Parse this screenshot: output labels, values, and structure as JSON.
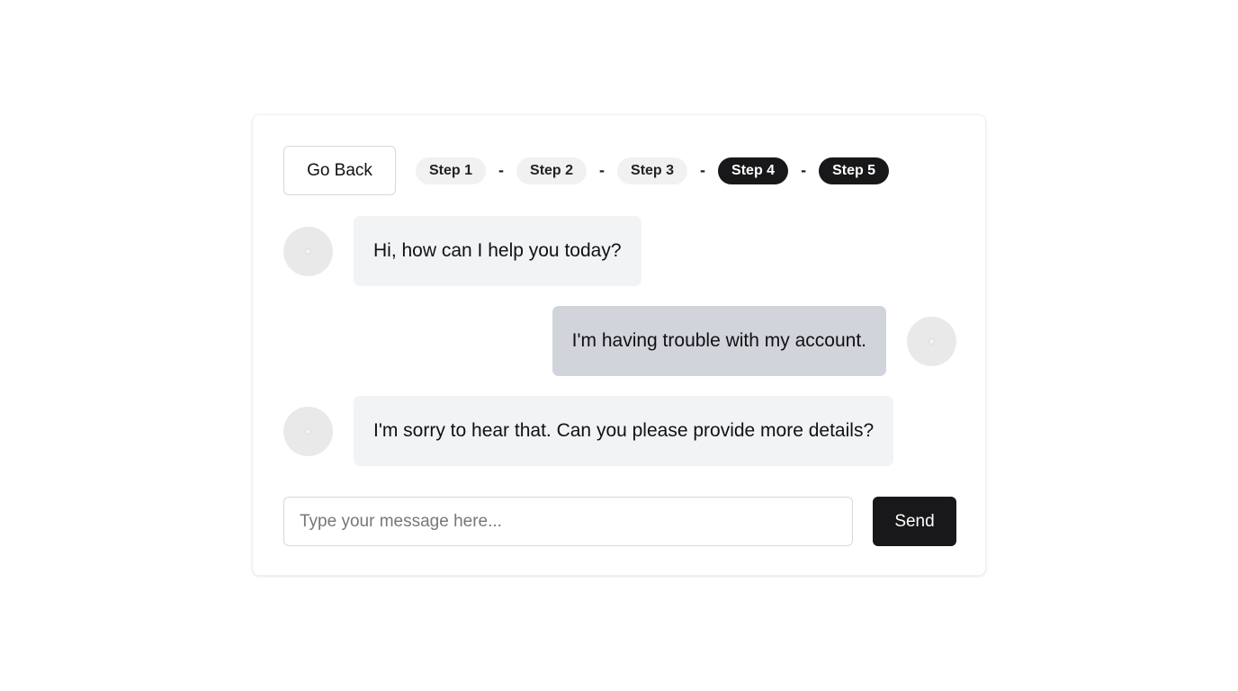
{
  "nav": {
    "back_label": "Go Back"
  },
  "steps": [
    {
      "label": "Step 1",
      "active": false
    },
    {
      "label": "Step 2",
      "active": false
    },
    {
      "label": "Step 3",
      "active": false
    },
    {
      "label": "Step 4",
      "active": true
    },
    {
      "label": "Step 5",
      "active": true
    }
  ],
  "step_separator": "-",
  "messages": [
    {
      "sender": "bot",
      "text": "Hi, how can I help you today?"
    },
    {
      "sender": "user",
      "text": "I'm having trouble with my account."
    },
    {
      "sender": "bot",
      "text": "I'm sorry to hear that. Can you please provide more details?"
    }
  ],
  "composer": {
    "placeholder": "Type your message here...",
    "value": "",
    "send_label": "Send"
  },
  "colors": {
    "accent": "#18181a",
    "bot_bubble": "#f2f3f5",
    "user_bubble": "#d1d4db",
    "inactive_step": "#f1f1f2"
  }
}
